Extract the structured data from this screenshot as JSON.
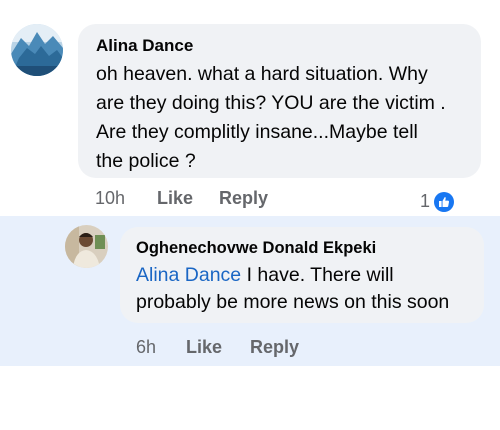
{
  "comment": {
    "author": "Alina Dance",
    "lines": [
      "oh heaven. what a hard situation. Why",
      "are they doing this? YOU are the victim .",
      "Are they complitly insane...Maybe tell",
      "the police ?"
    ],
    "time": "10h",
    "like_label": "Like",
    "reply_label": "Reply",
    "reaction_count": "1",
    "reaction_icon": "thumbs-up-icon"
  },
  "reply": {
    "author": "Oghenechovwe Donald Ekpeki",
    "mention": "Alina Dance",
    "line1_rest": " I have. There will",
    "line2": "probably be more news on this soon",
    "time": "6h",
    "like_label": "Like",
    "reply_label": "Reply"
  },
  "colors": {
    "bubble": "#f0f2f5",
    "reply_background": "#e8f0fc",
    "mention": "#1a66c4",
    "secondary_text": "#65676b",
    "like_badge": "#1877f2"
  }
}
